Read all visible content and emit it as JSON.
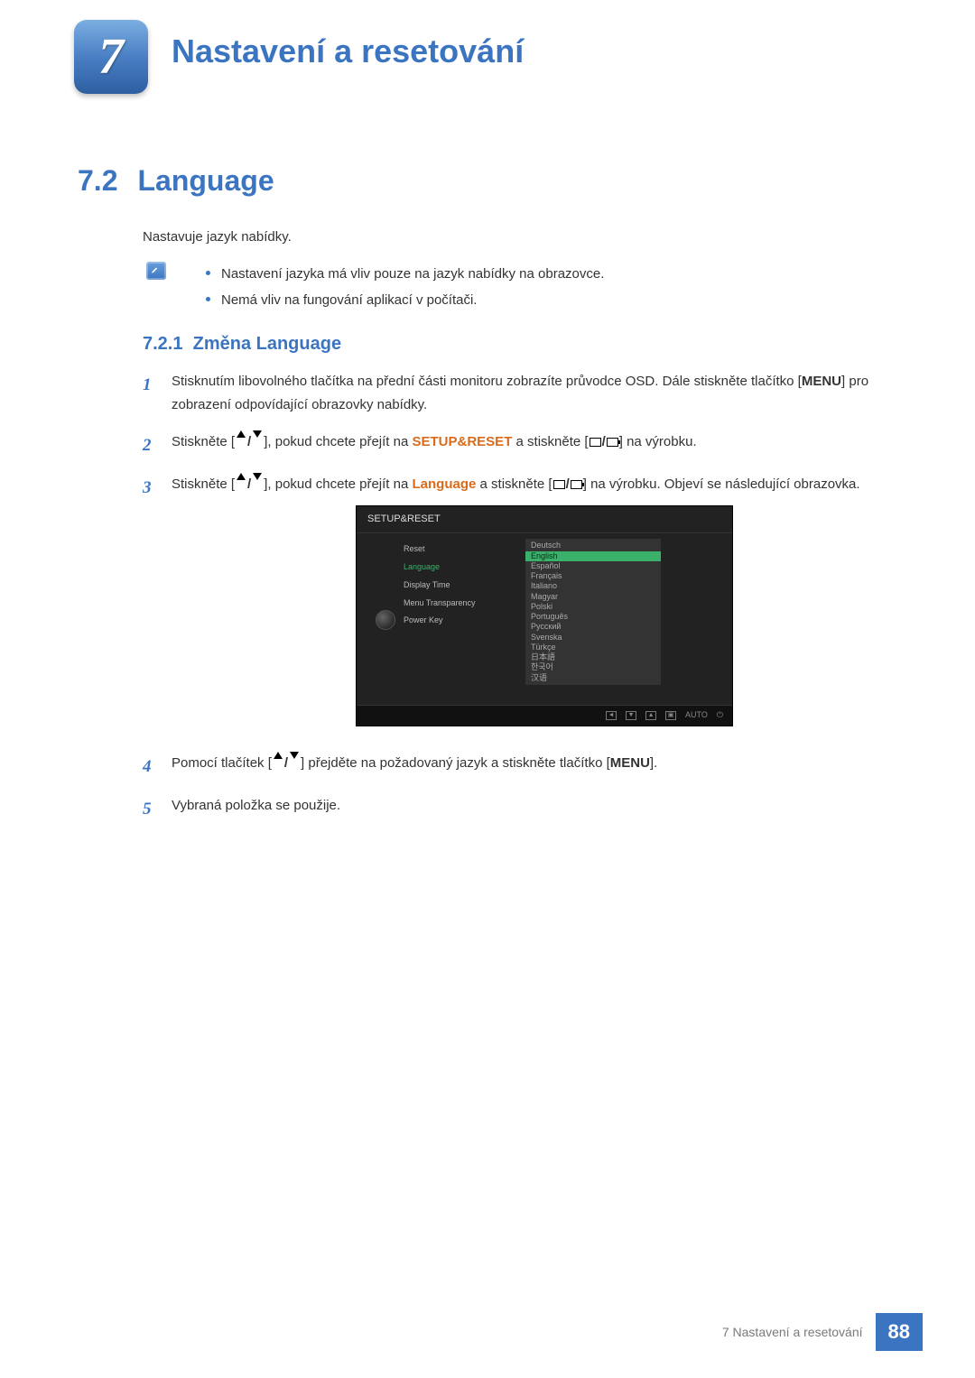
{
  "chapter": {
    "number": "7",
    "title": "Nastavení a resetování"
  },
  "section": {
    "number": "7.2",
    "title": "Language"
  },
  "intro": "Nastavuje jazyk nabídky.",
  "notes": [
    "Nastavení jazyka má vliv pouze na jazyk nabídky na obrazovce.",
    "Nemá vliv na fungování aplikací v počítači."
  ],
  "subsection": {
    "number": "7.2.1",
    "title": "Změna Language"
  },
  "steps": {
    "s1a": "Stisknutím libovolného tlačítka na přední části monitoru zobrazíte průvodce OSD. Dále stiskněte tlačítko [",
    "s1b": "] pro zobrazení odpovídající obrazovky nabídky.",
    "s2a": "Stiskněte [",
    "s2b": "], pokud chcete přejít na ",
    "s2c": " a stiskněte [",
    "s2d": "] na výrobku.",
    "s3a": "Stiskněte [",
    "s3b": "], pokud chcete přejít na ",
    "s3c": " a stiskněte [",
    "s3d": "] na výrobku. Objeví se následující obrazovka.",
    "s4a": "Pomocí tlačítek [",
    "s4b": "] přejděte na požadovaný jazyk a stiskněte tlačítko [",
    "s4c": "].",
    "s5": "Vybraná položka se použije."
  },
  "labels": {
    "menu": "MENU",
    "setupreset": "SETUP&RESET",
    "language": "Language"
  },
  "osd": {
    "title": "SETUP&RESET",
    "left_menu": [
      "Reset",
      "Language",
      "Display Time",
      "Menu Transparency",
      "Power Key"
    ],
    "selected": "Language",
    "languages": [
      "Deutsch",
      "English",
      "Español",
      "Français",
      "Italiano",
      "Magyar",
      "Polski",
      "Português",
      "Русский",
      "Svenska",
      "Türkçe",
      "日本語",
      "한국어",
      "汉语"
    ],
    "highlighted": "English",
    "footer_auto": "AUTO"
  },
  "footer": {
    "label": "7 Nastavení a resetování",
    "page": "88"
  }
}
